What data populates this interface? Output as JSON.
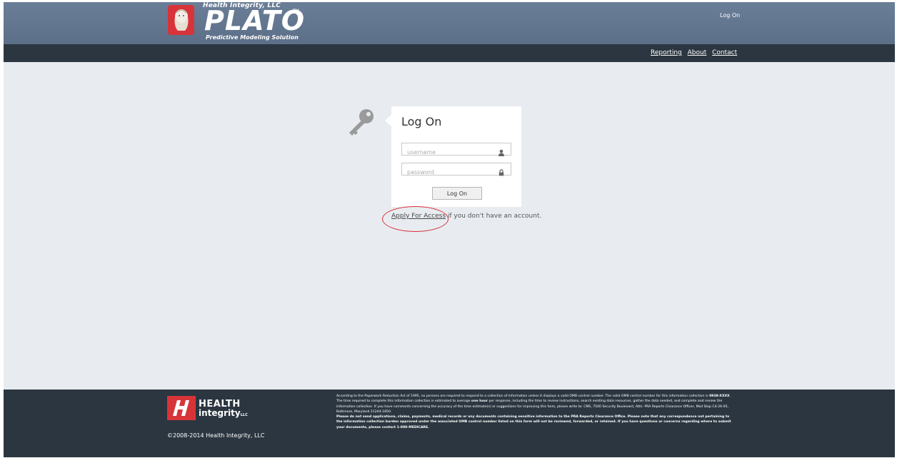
{
  "header": {
    "company": "Health Integrity, LLC",
    "product": "PLATO",
    "trademark": "TM",
    "tagline": "Predictive Modeling Solution",
    "logon_link": "Log On"
  },
  "nav": {
    "items": [
      {
        "label": "Reporting"
      },
      {
        "label": "About"
      },
      {
        "label": "Contact"
      }
    ]
  },
  "login": {
    "title": "Log On",
    "username_placeholder": "username",
    "password_placeholder": "password",
    "submit_label": "Log On",
    "apply_link": "Apply For Access",
    "apply_suffix": " if you don't have an account."
  },
  "footer": {
    "brand_line1": "HEALTH",
    "brand_line2": "integrity",
    "brand_suffix": "LLC",
    "copyright": "©2008-2014 Health Integrity, LLC",
    "notice": {
      "p1": "According to the Paperwork Reduction Act of 1995, no persons are required to respond to a collection of information unless it displays a valid OMB control number. The valid OMB control number for this information collection is ",
      "omb_number": "0938-XXXX",
      "p2": ". The time required to complete this information collection is estimated to average ",
      "time_estimate": "one hour",
      "p3": " per response, including the time to review instructions, search existing data resources, gather the data needed, and complete and review the information collection. If you have comments concerning the accuracy of the time estimate(s) or suggestions for improving this form, please write to: CMS, 7500 Security Boulevard, Attn: PRA Reports Clearance Officer, Mail Stop C4-26-05, Baltimore, Maryland 21244-1850.",
      "bold_text": "Please do not send applications, claims, payments, medical records or any documents containing sensitive information to the PRA Reports Clearance Office. Please note that any correspondence not pertaining to the information collection burden approved under the associated OMB control number listed on this form will not be reviewed, forwarded, or retained. If you have questions or concerns regarding where to submit your documents, please contact 1-800-MEDICARE."
    }
  },
  "colors": {
    "header_bg": "#5c6f88",
    "nav_bg": "#2b3640",
    "page_bg": "#e8ecf0",
    "brand_red": "#d7343a",
    "annotation_red": "#d62f3a"
  }
}
